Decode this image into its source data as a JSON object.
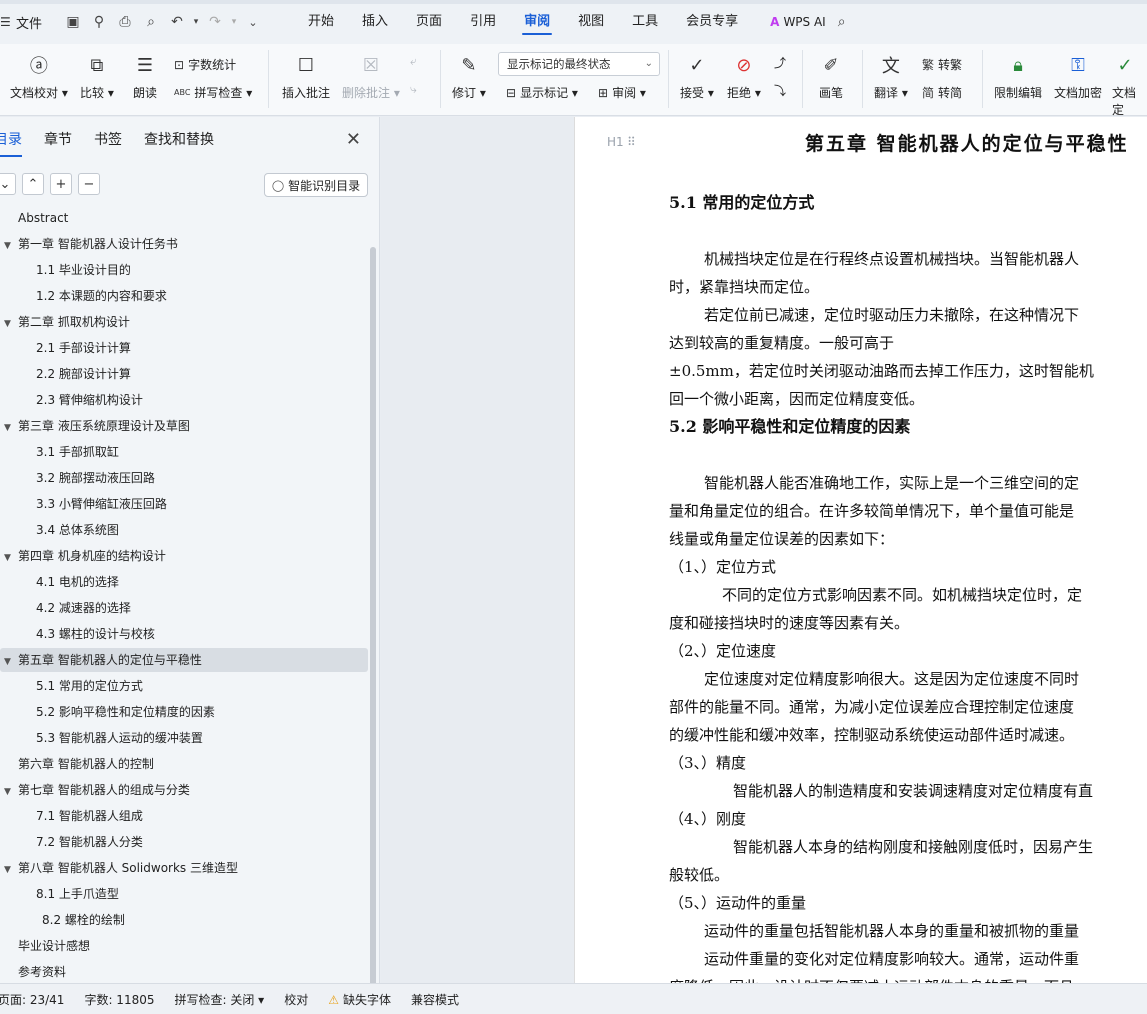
{
  "menu": {
    "file_label": "文件",
    "tabs": [
      "开始",
      "插入",
      "页面",
      "引用",
      "审阅",
      "视图",
      "工具",
      "会员专享"
    ],
    "active_tab": "审阅",
    "wps_ai": "WPS AI"
  },
  "ribbon": {
    "doc_check": "文档校对",
    "compare": "比较",
    "read_aloud": "朗读",
    "word_count": "字数统计",
    "spell_check": "拼写检查",
    "insert_comment": "插入批注",
    "delete_comment": "删除批注",
    "track_changes": "修订",
    "markup_state": "显示标记的最终状态",
    "show_markup": "显示标记",
    "review": "审阅",
    "accept": "接受",
    "reject": "拒绝",
    "ink": "画笔",
    "translate": "翻译",
    "to_traditional": "转繁",
    "to_simplified": "转简",
    "restrict_edit": "限制编辑",
    "doc_encrypt": "文档加密",
    "doc_finalize": "文档定"
  },
  "nav": {
    "tabs": [
      "目录",
      "章节",
      "书签",
      "查找和替换"
    ],
    "smart_toc": "智能识别目录",
    "toc": [
      {
        "text": "Abstract",
        "level": 0,
        "tri": false
      },
      {
        "text": "第一章  智能机器人设计任务书",
        "level": 0,
        "tri": true
      },
      {
        "text": "1.1 毕业设计目的",
        "level": 1,
        "tri": false
      },
      {
        "text": "1.2 本课题的内容和要求",
        "level": 1,
        "tri": false
      },
      {
        "text": "第二章  抓取机构设计",
        "level": 0,
        "tri": true
      },
      {
        "text": "2.1 手部设计计算",
        "level": 1,
        "tri": false
      },
      {
        "text": "2.2 腕部设计计算",
        "level": 1,
        "tri": false
      },
      {
        "text": "2.3 臂伸缩机构设计",
        "level": 1,
        "tri": false
      },
      {
        "text": "第三章  液压系统原理设计及草图",
        "level": 0,
        "tri": true
      },
      {
        "text": "3.1 手部抓取缸",
        "level": 1,
        "tri": false
      },
      {
        "text": "3.2 腕部摆动液压回路",
        "level": 1,
        "tri": false
      },
      {
        "text": "3.3 小臂伸缩缸液压回路",
        "level": 1,
        "tri": false
      },
      {
        "text": "3.4 总体系统图",
        "level": 1,
        "tri": false
      },
      {
        "text": "第四章  机身机座的结构设计",
        "level": 0,
        "tri": true
      },
      {
        "text": "4.1 电机的选择",
        "level": 1,
        "tri": false
      },
      {
        "text": "4.2 减速器的选择",
        "level": 1,
        "tri": false
      },
      {
        "text": "4.3 螺柱的设计与校核",
        "level": 1,
        "tri": false
      },
      {
        "text": "第五章  智能机器人的定位与平稳性",
        "level": 0,
        "tri": true
      },
      {
        "text": "5.1 常用的定位方式",
        "level": 1,
        "tri": false
      },
      {
        "text": "5.2 影响平稳性和定位精度的因素",
        "level": 1,
        "tri": false
      },
      {
        "text": "5.3 智能机器人运动的缓冲装置",
        "level": 1,
        "tri": false
      },
      {
        "text": "第六章  智能机器人的控制",
        "level": 0,
        "tri": false
      },
      {
        "text": "第七章  智能机器人的组成与分类",
        "level": 0,
        "tri": true
      },
      {
        "text": "7.1 智能机器人组成",
        "level": 1,
        "tri": false
      },
      {
        "text": "7.2 智能机器人分类",
        "level": 1,
        "tri": false
      },
      {
        "text": "第八章  智能机器人 Solidworks 三维造型",
        "level": 0,
        "tri": true
      },
      {
        "text": "8.1 上手爪造型",
        "level": 1,
        "tri": false
      },
      {
        "text": "8.2 螺栓的绘制",
        "level": 2,
        "tri": false
      },
      {
        "text": "毕业设计感想",
        "level": 0,
        "tri": false
      },
      {
        "text": "参考资料",
        "level": 0,
        "tri": false
      }
    ],
    "selected_index": 17
  },
  "doc": {
    "heading_marker": "H1",
    "title": "第五章  智能机器人的定位与平稳性",
    "lines": [
      {
        "text": "5.1 常用的定位方式",
        "kind": "h2"
      },
      {
        "text": "机械挡块定位是在行程终点设置机械挡块。当智能机器人",
        "kind": "p1"
      },
      {
        "text": "时，紧靠挡块而定位。",
        "kind": "p"
      },
      {
        "text": "若定位前已减速，定位时驱动压力未撤除，在这种情况下",
        "kind": "p1"
      },
      {
        "text": "达到较高的重复精度。一般可高于",
        "kind": "p"
      },
      {
        "text": "±0.5mm，若定位时关闭驱动油路而去掉工作压力，这时智能机",
        "kind": "p"
      },
      {
        "text": "回一个微小距离，因而定位精度变低。",
        "kind": "p"
      },
      {
        "text": "5.2 影响平稳性和定位精度的因素",
        "kind": "h2"
      },
      {
        "text": "智能机器人能否准确地工作，实际上是一个三维空间的定",
        "kind": "p1"
      },
      {
        "text": "量和角量定位的组合。在许多较简单情况下，单个量值可能是",
        "kind": "p"
      },
      {
        "text": "线量或角量定位误差的因素如下：",
        "kind": "p"
      },
      {
        "text": "（1、）定位方式",
        "kind": "item"
      },
      {
        "text": "不同的定位方式影响因素不同。如机械挡块定位时，定",
        "kind": "p2"
      },
      {
        "text": "度和碰接挡块时的速度等因素有关。",
        "kind": "p"
      },
      {
        "text": "（2、）定位速度",
        "kind": "item"
      },
      {
        "text": "定位速度对定位精度影响很大。这是因为定位速度不同时",
        "kind": "p1"
      },
      {
        "text": "部件的能量不同。通常，为减小定位误差应合理控制定位速度",
        "kind": "p"
      },
      {
        "text": "的缓冲性能和缓冲效率，控制驱动系统使运动部件适时减速。",
        "kind": "p"
      },
      {
        "text": "（3、）精度",
        "kind": "item"
      },
      {
        "text": "智能机器人的制造精度和安装调速精度对定位精度有直",
        "kind": "p3"
      },
      {
        "text": "（4、）刚度",
        "kind": "item"
      },
      {
        "text": "智能机器人本身的结构刚度和接触刚度低时，因易产生",
        "kind": "p3"
      },
      {
        "text": "般较低。",
        "kind": "p"
      },
      {
        "text": "（5、）运动件的重量",
        "kind": "item"
      },
      {
        "text": "运动件的重量包括智能机器人本身的重量和被抓物的重量",
        "kind": "p1"
      },
      {
        "text": "运动件重量的变化对定位精度影响较大。通常，运动件重",
        "kind": "p1"
      },
      {
        "text": "度降低。因此，设计时不仅要减小运动部件本身的重量，而且",
        "kind": "p"
      }
    ]
  },
  "status": {
    "page": "页面: 23/41",
    "words": "字数: 11805",
    "spell": "拼写检查: 关闭",
    "proof": "校对",
    "missing_font": "缺失字体",
    "compat": "兼容模式"
  }
}
